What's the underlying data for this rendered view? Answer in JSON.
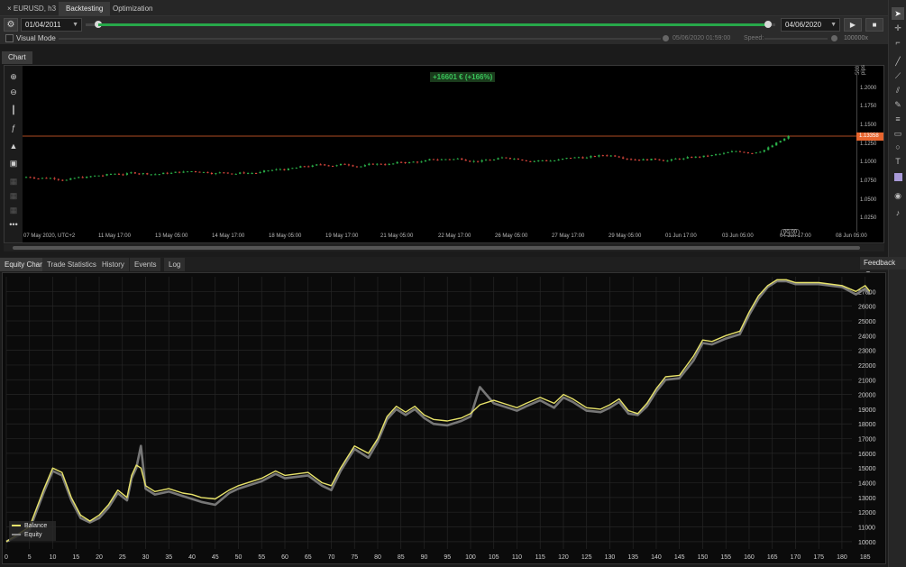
{
  "window": {
    "symbol_tab": "EURUSD, h3",
    "tabs": [
      "Backtesting",
      "Optimization"
    ]
  },
  "controls": {
    "start_date": "01/04/2011",
    "end_date": "04/06/2020",
    "progress_fraction": 0.99,
    "play_icon": "play-icon",
    "stop_icon": "stop-icon"
  },
  "visual_mode": {
    "label": "Visual Mode",
    "timestamp": "05/06/2020 01:59:00",
    "speed_label": "Speed:",
    "speed_value": "100000x"
  },
  "chart": {
    "tab": "Chart",
    "profit_badge": "+16601 € (+166%)",
    "pips_label": "500 pips",
    "current_price": "1.13358",
    "zoom_badge": "00.00",
    "price_labels": [
      "1.2000",
      "1.1750",
      "1.1500",
      "1.1250",
      "1.1000",
      "1.0750",
      "1.0500",
      "1.0250"
    ],
    "time_labels": [
      "07 May 2020, UTC+2",
      "11 May 17:00",
      "13 May 05:00",
      "14 May 17:00",
      "18 May 05:00",
      "19 May 17:00",
      "21 May 05:00",
      "22 May 17:00",
      "26 May 05:00",
      "27 May 17:00",
      "29 May 05:00",
      "01 Jun 17:00",
      "03 Jun 05:00",
      "04 Jun 17:00",
      "08 Jun 05:00"
    ],
    "colors": {
      "up": "#2bb24a",
      "down": "#e0483e",
      "price_line": "#e8652e"
    }
  },
  "bottom_tabs": [
    "Equity Chart",
    "Trade Statistics",
    "History",
    "Events",
    "Log"
  ],
  "feedback": {
    "label": "Feedback",
    "icon": "chat-bubble-icon"
  },
  "chart_data": {
    "type": "line",
    "xlabel": "",
    "ylabel": "",
    "xlim": [
      0,
      187
    ],
    "ylim": [
      9500,
      28000
    ],
    "x_ticks": [
      0,
      5,
      10,
      15,
      20,
      25,
      30,
      35,
      40,
      45,
      50,
      55,
      60,
      65,
      70,
      75,
      80,
      85,
      90,
      95,
      100,
      105,
      110,
      115,
      120,
      125,
      130,
      135,
      140,
      145,
      150,
      155,
      160,
      165,
      170,
      175,
      180,
      185
    ],
    "y_ticks": [
      10000,
      11000,
      12000,
      13000,
      14000,
      15000,
      16000,
      17000,
      18000,
      19000,
      20000,
      21000,
      22000,
      23000,
      24000,
      25000,
      26000,
      27000
    ],
    "grid": true,
    "legend_position": "bottom-left",
    "series": [
      {
        "name": "Balance",
        "color": "#e8e36a",
        "x": [
          0,
          5,
          8,
          10,
          12,
          14,
          16,
          18,
          20,
          22,
          24,
          26,
          27,
          28,
          29,
          30,
          32,
          35,
          38,
          40,
          42,
          45,
          48,
          50,
          55,
          58,
          60,
          65,
          68,
          70,
          72,
          75,
          78,
          80,
          82,
          84,
          86,
          88,
          90,
          92,
          95,
          98,
          100,
          102,
          105,
          108,
          110,
          112,
          115,
          118,
          120,
          122,
          125,
          128,
          130,
          132,
          134,
          136,
          138,
          140,
          142,
          145,
          148,
          150,
          152,
          155,
          158,
          160,
          162,
          164,
          166,
          168,
          170,
          175,
          180,
          183,
          185,
          186
        ],
        "y": [
          10000,
          11000,
          13500,
          15000,
          14700,
          13000,
          11800,
          11400,
          11800,
          12500,
          13500,
          13000,
          14500,
          15200,
          15000,
          13800,
          13400,
          13600,
          13300,
          13200,
          13000,
          12900,
          13500,
          13800,
          14300,
          14800,
          14500,
          14700,
          14000,
          13800,
          15000,
          16500,
          16000,
          17000,
          18500,
          19200,
          18800,
          19200,
          18600,
          18300,
          18200,
          18400,
          18700,
          19300,
          19600,
          19300,
          19100,
          19400,
          19800,
          19400,
          20000,
          19700,
          19100,
          19000,
          19300,
          19700,
          18900,
          18700,
          19400,
          20400,
          21200,
          21300,
          22600,
          23700,
          23600,
          24000,
          24300,
          25600,
          26700,
          27400,
          27800,
          27800,
          27600,
          27600,
          27400,
          27000,
          27400,
          27000
        ]
      },
      {
        "name": "Equity",
        "color": "#8a8a8a",
        "x": [
          0,
          5,
          8,
          10,
          12,
          14,
          16,
          18,
          20,
          22,
          24,
          26,
          27,
          28,
          29,
          30,
          32,
          35,
          38,
          40,
          42,
          45,
          48,
          50,
          55,
          58,
          60,
          65,
          68,
          70,
          72,
          75,
          78,
          80,
          82,
          84,
          86,
          88,
          90,
          92,
          95,
          98,
          100,
          102,
          105,
          108,
          110,
          112,
          115,
          118,
          120,
          122,
          125,
          128,
          130,
          132,
          134,
          136,
          138,
          140,
          142,
          145,
          148,
          150,
          152,
          155,
          158,
          160,
          162,
          164,
          166,
          168,
          170,
          175,
          180,
          183,
          185,
          186
        ],
        "y": [
          10000,
          10800,
          13300,
          14800,
          14500,
          12800,
          11600,
          11300,
          11600,
          12300,
          13300,
          12800,
          14300,
          15000,
          16500,
          13600,
          13200,
          13400,
          13100,
          12900,
          12700,
          12500,
          13300,
          13600,
          14100,
          14600,
          14300,
          14500,
          13800,
          13500,
          14800,
          16300,
          15700,
          16800,
          18300,
          19000,
          18600,
          19000,
          18400,
          18000,
          17900,
          18200,
          18500,
          20500,
          19400,
          19100,
          18900,
          19200,
          19600,
          19100,
          19800,
          19500,
          18900,
          18800,
          19100,
          19500,
          18700,
          18600,
          19200,
          20200,
          21000,
          21100,
          22300,
          23500,
          23400,
          23800,
          24100,
          25400,
          26500,
          27300,
          27700,
          27700,
          27500,
          27500,
          27300,
          26800,
          27200,
          26800
        ]
      }
    ]
  }
}
